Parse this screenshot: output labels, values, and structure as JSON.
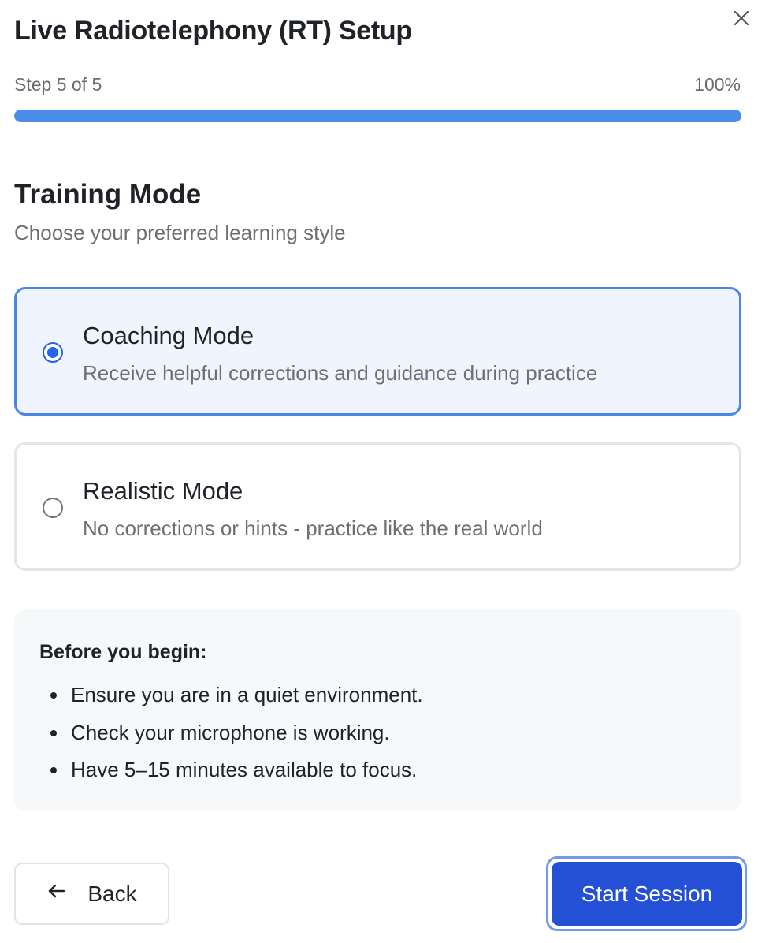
{
  "dialog": {
    "title": "Live Radiotelephony (RT) Setup",
    "close_icon": "close-icon"
  },
  "progress": {
    "step_label": "Step 5 of 5",
    "percent_label": "100%",
    "value_percent": 100,
    "fill_color": "#4a8ee8"
  },
  "section": {
    "title": "Training Mode",
    "subtitle": "Choose your preferred learning style"
  },
  "modes": [
    {
      "title": "Coaching Mode",
      "description": "Receive helpful corrections and guidance during practice",
      "selected": true
    },
    {
      "title": "Realistic Mode",
      "description": "No corrections or hints - practice like the real world",
      "selected": false
    }
  ],
  "checklist": {
    "heading": "Before you begin:",
    "items": [
      "Ensure you are in a quiet environment.",
      "Check your microphone is working.",
      "Have 5–15 minutes available to focus."
    ]
  },
  "footer": {
    "back_label": "Back",
    "back_icon": "arrow-left-icon",
    "start_label": "Start Session"
  },
  "colors": {
    "accent": "#2563eb",
    "primary_button": "#2450d6",
    "selected_card_bg": "#eff4fe"
  }
}
